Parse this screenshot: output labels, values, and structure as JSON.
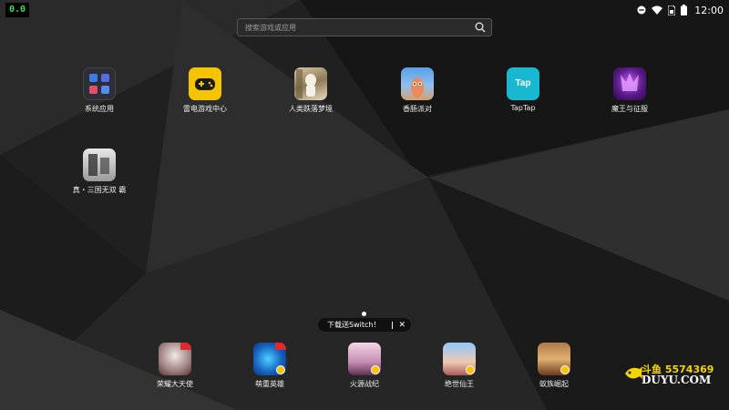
{
  "status_bar": {
    "fps": "0.0",
    "time": "12:00",
    "icons": [
      "minus-circle-icon",
      "wifi-icon",
      "sim-card-icon",
      "battery-icon"
    ]
  },
  "search": {
    "placeholder": "搜索游戏或应用",
    "icon": "search-icon"
  },
  "apps": [
    {
      "label": "系统应用",
      "icon": "system-apps-folder-icon"
    },
    {
      "label": "雷电游戏中心",
      "icon": "gamepad-icon"
    },
    {
      "label": "人类跌落梦境",
      "icon": "human-fall-flat-icon"
    },
    {
      "label": "香肠派对",
      "icon": "sausage-party-icon"
    },
    {
      "label": "TapTap",
      "icon": "taptap-icon",
      "icon_text": "Tap"
    },
    {
      "label": "魔王与征服",
      "icon": "demon-king-icon"
    },
    {
      "label": "真・三国无双 霸",
      "icon": "dynasty-warriors-icon"
    }
  ],
  "page_indicator": {
    "current": 1,
    "total": 1
  },
  "tooltip": {
    "text": "下载送Switch！",
    "close": "✕"
  },
  "dock": [
    {
      "label": "荣耀大天使",
      "icon": "archangel-icon"
    },
    {
      "label": "萌重英雄",
      "icon": "cute-hero-icon"
    },
    {
      "label": "火源战纪",
      "icon": "fire-origin-icon"
    },
    {
      "label": "绝世仙王",
      "icon": "immortal-king-icon"
    },
    {
      "label": "蚁族崛起",
      "icon": "ant-rise-icon"
    }
  ],
  "watermark": {
    "brand": "斗鱼",
    "room": "5574369",
    "site": "DUYU.COM"
  },
  "colors": {
    "accent_green": "#2ee64a",
    "badge_yellow": "#f7c300",
    "taptap": "#19b8d1",
    "leidian": "#f5c400"
  }
}
